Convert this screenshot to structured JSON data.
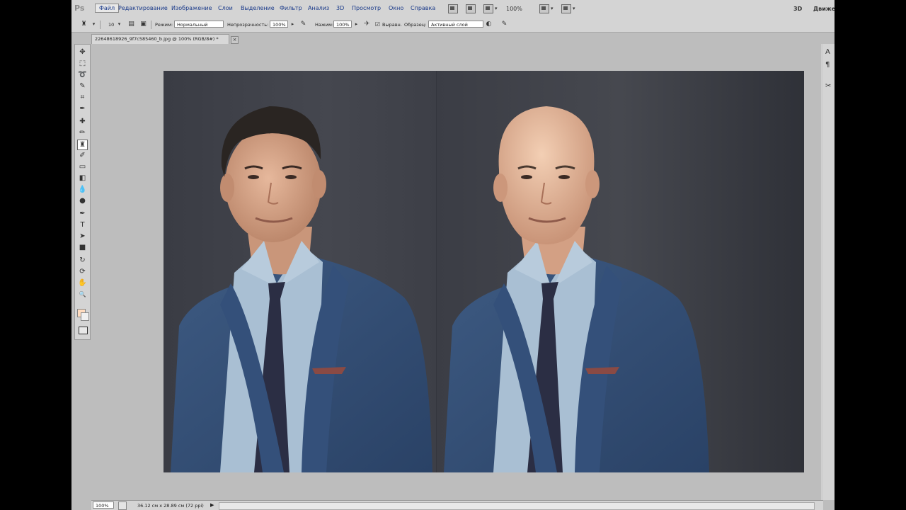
{
  "app": {
    "logo": "Ps"
  },
  "menu": {
    "items": [
      "Файл",
      "Редактирование",
      "Изображение",
      "Слои",
      "Выделение",
      "Фильтр",
      "Анализ",
      "3D",
      "Просмотр",
      "Окно",
      "Справка"
    ],
    "zoom": "100%",
    "workspace_3d": "3D",
    "workspace_motion": "Движе"
  },
  "options": {
    "brush_size": "10",
    "mode_label": "Режим:",
    "mode_value": "Нормальный",
    "opacity_label": "Непрозрачность:",
    "opacity_value": "100%",
    "flow_label": "Нажим:",
    "flow_value": "100%",
    "aligned_label": "Выравн.",
    "sample_label": "Образец:",
    "sample_value": "Активный слой"
  },
  "document": {
    "tab_title": "22648618926_9f7c585460_b.jpg @ 100% (RGB/8#) *",
    "close_glyph": "×"
  },
  "tools": [
    {
      "icon": "move-icon",
      "glyph": "✥"
    },
    {
      "icon": "marquee-icon",
      "glyph": "⬚"
    },
    {
      "icon": "lasso-icon",
      "glyph": "➰"
    },
    {
      "icon": "quick-select-icon",
      "glyph": "✎"
    },
    {
      "icon": "crop-icon",
      "glyph": "⌗"
    },
    {
      "icon": "eyedropper-icon",
      "glyph": "✒"
    },
    {
      "icon": "healing-icon",
      "glyph": "✚"
    },
    {
      "icon": "brush-icon",
      "glyph": "✏"
    },
    {
      "icon": "clone-stamp-icon",
      "glyph": "♜"
    },
    {
      "icon": "history-brush-icon",
      "glyph": "✐"
    },
    {
      "icon": "eraser-icon",
      "glyph": "▭"
    },
    {
      "icon": "gradient-icon",
      "glyph": "◧"
    },
    {
      "icon": "blur-icon",
      "glyph": "💧"
    },
    {
      "icon": "dodge-icon",
      "glyph": "●"
    },
    {
      "icon": "pen-icon",
      "glyph": "✒"
    },
    {
      "icon": "type-icon",
      "glyph": "T"
    },
    {
      "icon": "path-select-icon",
      "glyph": "➤"
    },
    {
      "icon": "shape-icon",
      "glyph": "■"
    },
    {
      "icon": "3d-rotate-icon",
      "glyph": "↻"
    },
    {
      "icon": "3d-orbit-icon",
      "glyph": "⟳"
    },
    {
      "icon": "hand-icon",
      "glyph": "✋"
    },
    {
      "icon": "zoom-icon",
      "glyph": "🔍"
    }
  ],
  "colors": {
    "foreground": "#ffdcc0",
    "background": "#f0f0f0"
  },
  "status": {
    "zoom": "100%",
    "doc_info": "36.12 см x 28.89 см (72 ppi)",
    "arrow": "▶"
  },
  "right_panel": {
    "icons": [
      "A",
      "¶",
      "✂"
    ]
  }
}
